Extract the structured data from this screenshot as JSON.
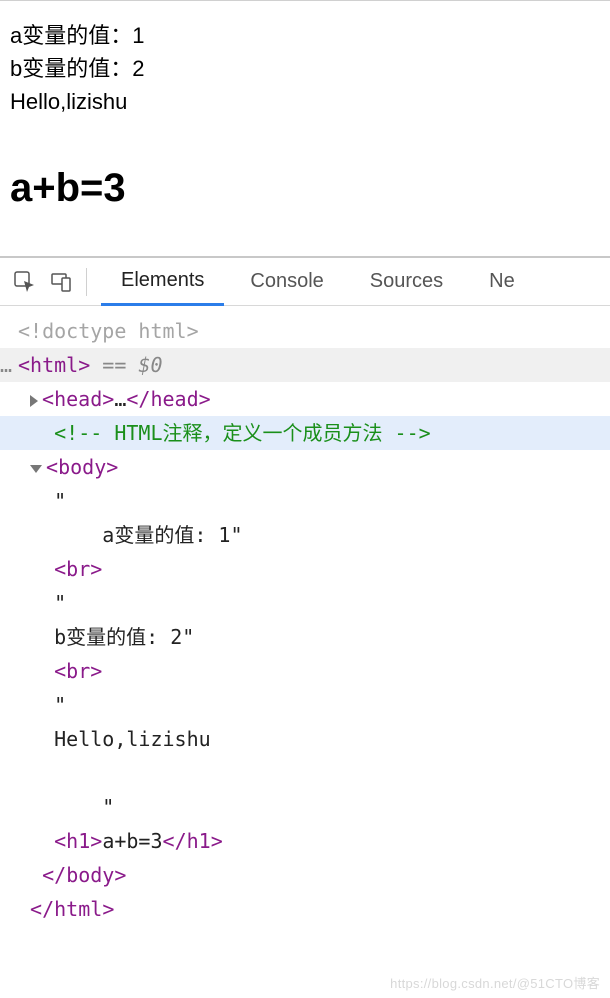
{
  "page": {
    "line1": "a变量的值：1",
    "line2": "b变量的值：2",
    "line3": "Hello,lizishu",
    "heading": "a+b=3"
  },
  "devtools": {
    "tabs": {
      "elements": "Elements",
      "console": "Console",
      "sources": "Sources",
      "network_partial": "Ne"
    },
    "code": {
      "doctype": "<!doctype html>",
      "html_open": "html",
      "sel_marker": " == $0",
      "head_open": "head",
      "head_ellipsis": "…",
      "head_close": "head",
      "comment": "<!-- HTML注释，定义一个成员方法 -->",
      "body_open": "body",
      "q": "\"",
      "text_a": "    a变量的值: 1\"",
      "br": "br",
      "text_b": "b变量的值: 2\"",
      "text_hello": "Hello,lizishu",
      "close_q": "    \"",
      "h1_open": "h1",
      "h1_text": "a+b=3",
      "h1_close": "h1",
      "body_close": "body",
      "html_close": "html"
    }
  },
  "watermark": "https://blog.csdn.net/@51CTO博客"
}
